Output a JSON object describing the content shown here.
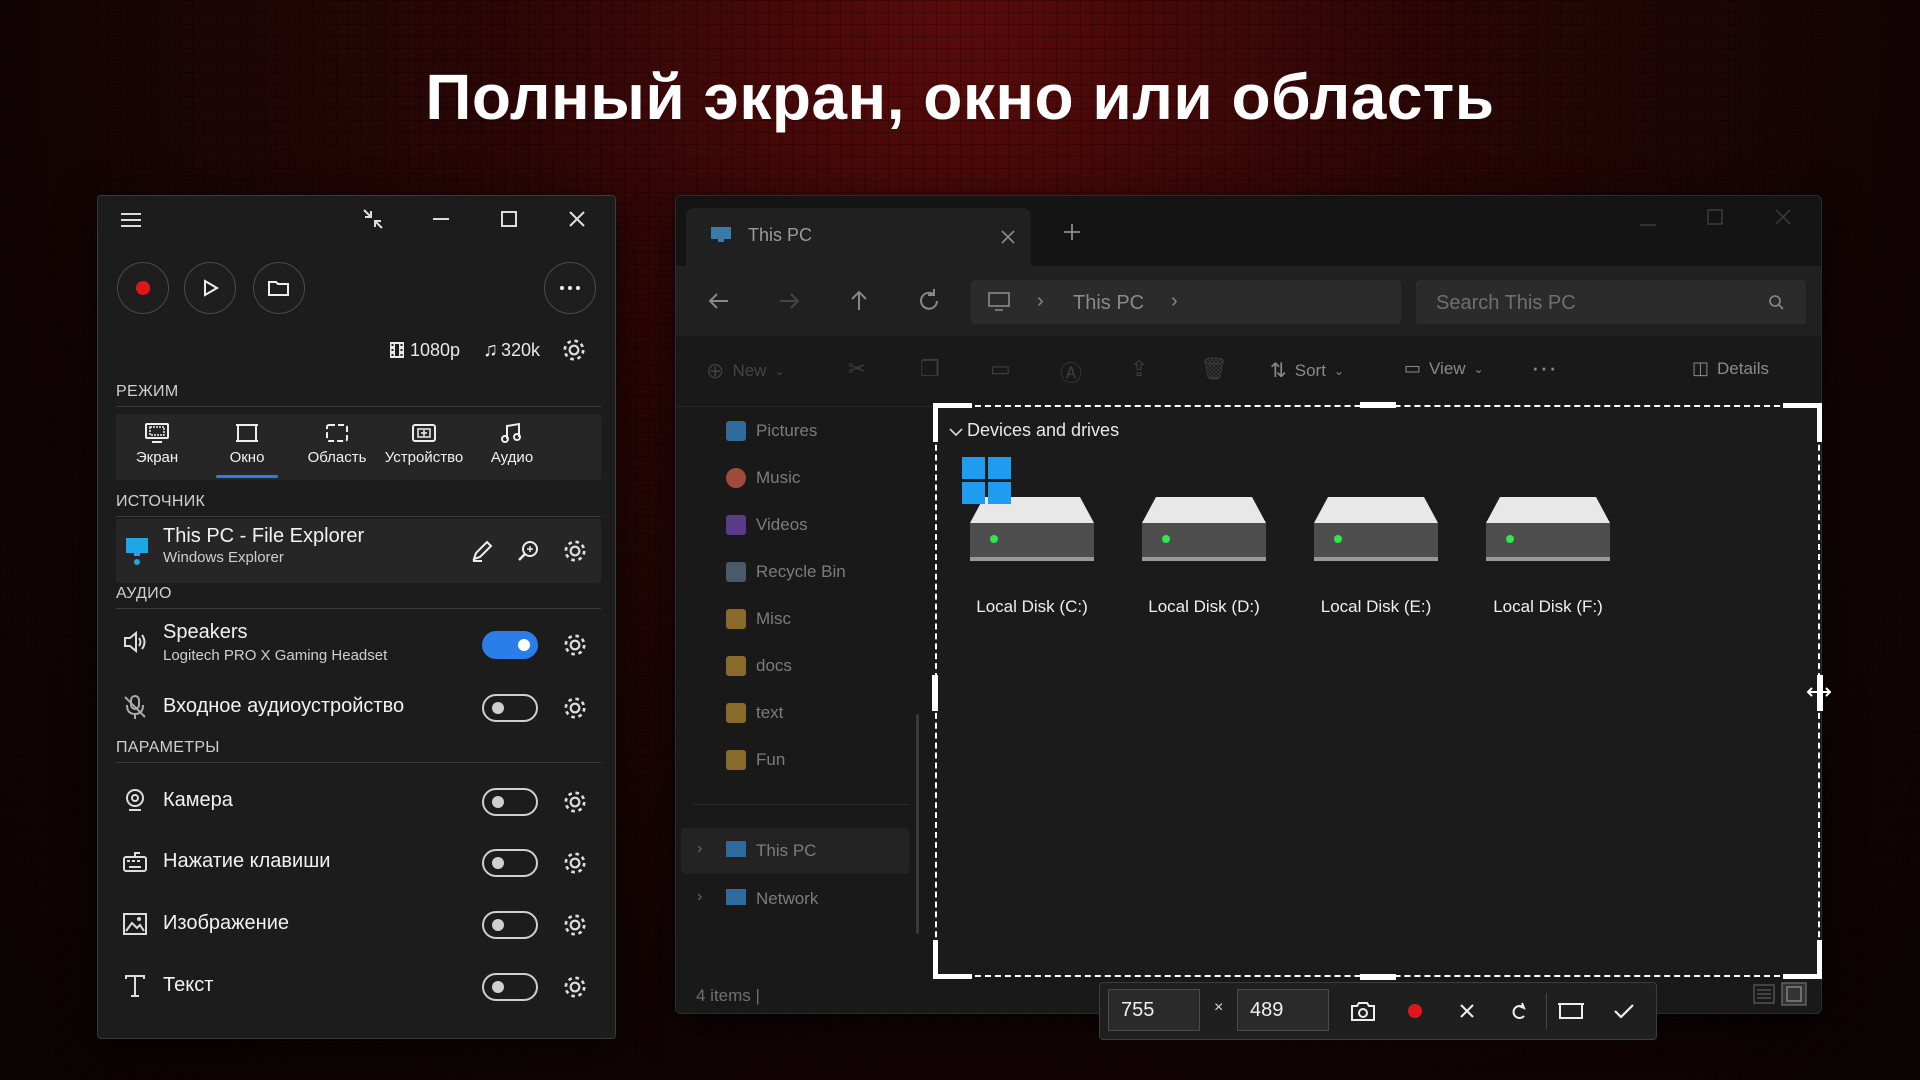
{
  "headline": "Полный экран, окно или область",
  "recorder": {
    "stats": {
      "resolution": "1080p",
      "bitrate": "320k"
    },
    "mode_label": "РЕЖИМ",
    "modes": [
      {
        "label": "Экран",
        "icon": "screen-icon"
      },
      {
        "label": "Окно",
        "icon": "window-icon",
        "selected": true
      },
      {
        "label": "Область",
        "icon": "area-icon"
      },
      {
        "label": "Устройство",
        "icon": "device-icon"
      },
      {
        "label": "Аудио",
        "icon": "audio-icon"
      }
    ],
    "source_label": "ИСТОЧНИК",
    "source": {
      "title": "This PC - File Explorer",
      "subtitle": "Windows Explorer"
    },
    "audio_label": "АУДИО",
    "audio": [
      {
        "title": "Speakers",
        "subtitle": "Logitech PRO X Gaming Headset",
        "on": true
      },
      {
        "title": "Входное аудиоустройство",
        "on": false
      }
    ],
    "params_label": "ПАРАМЕТРЫ",
    "params": [
      {
        "title": "Камера",
        "on": false
      },
      {
        "title": "Нажатие клавиши",
        "on": false
      },
      {
        "title": "Изображение",
        "on": false
      },
      {
        "title": "Текст",
        "on": false
      }
    ]
  },
  "explorer": {
    "tab_title": "This PC",
    "address": "This PC",
    "search_placeholder": "Search This PC",
    "commands": {
      "new": "New",
      "sort": "Sort",
      "view": "View",
      "details": "Details"
    },
    "sidebar": {
      "pinned": [
        "Pictures",
        "Music",
        "Videos",
        "Recycle Bin"
      ],
      "folders": [
        "Misc",
        "docs",
        "text",
        "Fun"
      ],
      "roots": [
        "This PC",
        "Network"
      ]
    },
    "section_title": "Devices and drives",
    "drives": [
      "Local Disk (C:)",
      "Local Disk (D:)",
      "Local Disk (E:)",
      "Local Disk (F:)"
    ],
    "status": "4 items  |"
  },
  "selection": {
    "width": "755",
    "height": "489",
    "times": "×"
  },
  "colors": {
    "accent": "#2b7de9",
    "record": "#e0161e"
  }
}
